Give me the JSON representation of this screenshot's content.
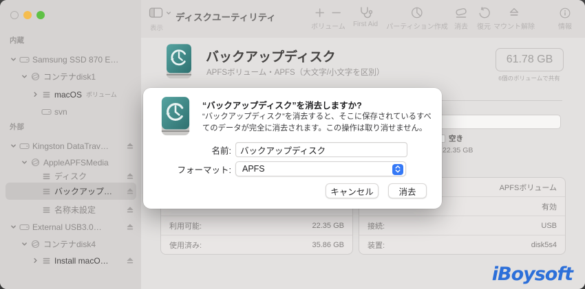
{
  "titlebar": {
    "app_title": "ディスクユーティリティ",
    "view_label": "表示"
  },
  "toolbar": {
    "items": [
      {
        "label": "ボリューム"
      },
      {
        "label": "First Aid"
      },
      {
        "label": "パーティション作成"
      },
      {
        "label": "消去"
      },
      {
        "label": "復元"
      },
      {
        "label": "マウント解除"
      },
      {
        "label": "情報"
      }
    ]
  },
  "sidebar": {
    "sections": {
      "internal": "内蔵",
      "external": "外部"
    },
    "items": [
      {
        "label": "Samsung SSD 870 E…"
      },
      {
        "label": "コンテナdisk1"
      },
      {
        "label": "macOS",
        "suffix": "ボリューム"
      },
      {
        "label": "svn"
      },
      {
        "label": "Kingston DataTrav…"
      },
      {
        "label": "AppleAPFSMedia"
      },
      {
        "label": "ディスク"
      },
      {
        "label": "バックアップ…"
      },
      {
        "label": "名称未設定"
      },
      {
        "label": "External USB3.0…"
      },
      {
        "label": "コンテナdisk4"
      },
      {
        "label": "Install macO…"
      }
    ]
  },
  "header": {
    "title": "バックアップディスク",
    "subtitle": "APFSボリューム・APFS（大文字/小文字を区別）",
    "size": "61.78 GB",
    "size_caption": "6個のボリュームで共有"
  },
  "legend": {
    "label": "空き",
    "value": "22.35 GB"
  },
  "info": {
    "left": [
      {
        "label": "",
        "value": ""
      },
      {
        "label": "",
        "value": ""
      },
      {
        "label": "利用可能:",
        "value": "22.35 GB"
      },
      {
        "label": "使用済み:",
        "value": "35.86 GB"
      }
    ],
    "right": [
      {
        "label": "",
        "value": "APFSボリューム"
      },
      {
        "label": "",
        "value": "有効"
      },
      {
        "label": "接続:",
        "value": "USB"
      },
      {
        "label": "装置:",
        "value": "disk5s4"
      }
    ]
  },
  "dialog": {
    "title": "“バックアップディスク”を消去しますか?",
    "body": "“バックアップディスク”を消去すると、そこに保存されているすべてのデータが完全に消去されます。この操作は取り消せません。",
    "name_label": "名前:",
    "name_value": "バックアップディスク",
    "format_label": "フォーマット:",
    "format_value": "APFS",
    "cancel_label": "キャンセル",
    "erase_label": "消去"
  },
  "watermark": "iBoysoft",
  "colors": {
    "accent_blue": "#3478f6",
    "teal_icon": "#3f8c8a",
    "watermark_blue": "#2c6fd9"
  }
}
